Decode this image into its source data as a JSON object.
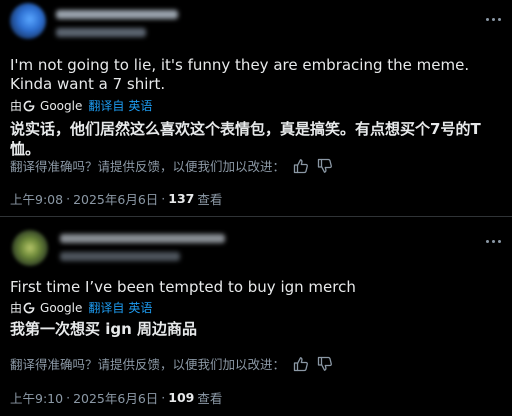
{
  "colors": {
    "background": "#000000",
    "text": "#e7e9ea",
    "secondary": "#8b98a5",
    "link": "#1d9bf0",
    "divider": "#2f3336"
  },
  "icons": {
    "more": "more-dots-icon",
    "translate_provider": "google-g-icon",
    "thumbs_up": "thumbs-up-icon",
    "thumbs_down": "thumbs-down-icon"
  },
  "posts": [
    {
      "text": "I'm not going to lie, it's funny they are embracing the meme. Kinda want a 7 shirt.",
      "translation": {
        "by": "由",
        "provider": "Google",
        "link": "翻译自",
        "language": "英语",
        "text": "说实话，他们居然这么喜欢这个表情包，真是搞笑。有点想买个7号的T恤。"
      },
      "feedback": "翻译得准确吗？请提供反馈，以便我们加以改进：",
      "time": "上午9:08",
      "date": "2025年6月6日",
      "views": "137",
      "views_label": "查看"
    },
    {
      "text": "First time I’ve been tempted to buy ign merch",
      "translation": {
        "by": "由",
        "provider": "Google",
        "link": "翻译自",
        "language": "英语",
        "text": "我第一次想买 ign 周边商品"
      },
      "feedback": "翻译得准确吗？请提供反馈，以便我们加以改进：",
      "time": "上午9:10",
      "date": "2025年6月6日",
      "views": "109",
      "views_label": "查看"
    }
  ]
}
